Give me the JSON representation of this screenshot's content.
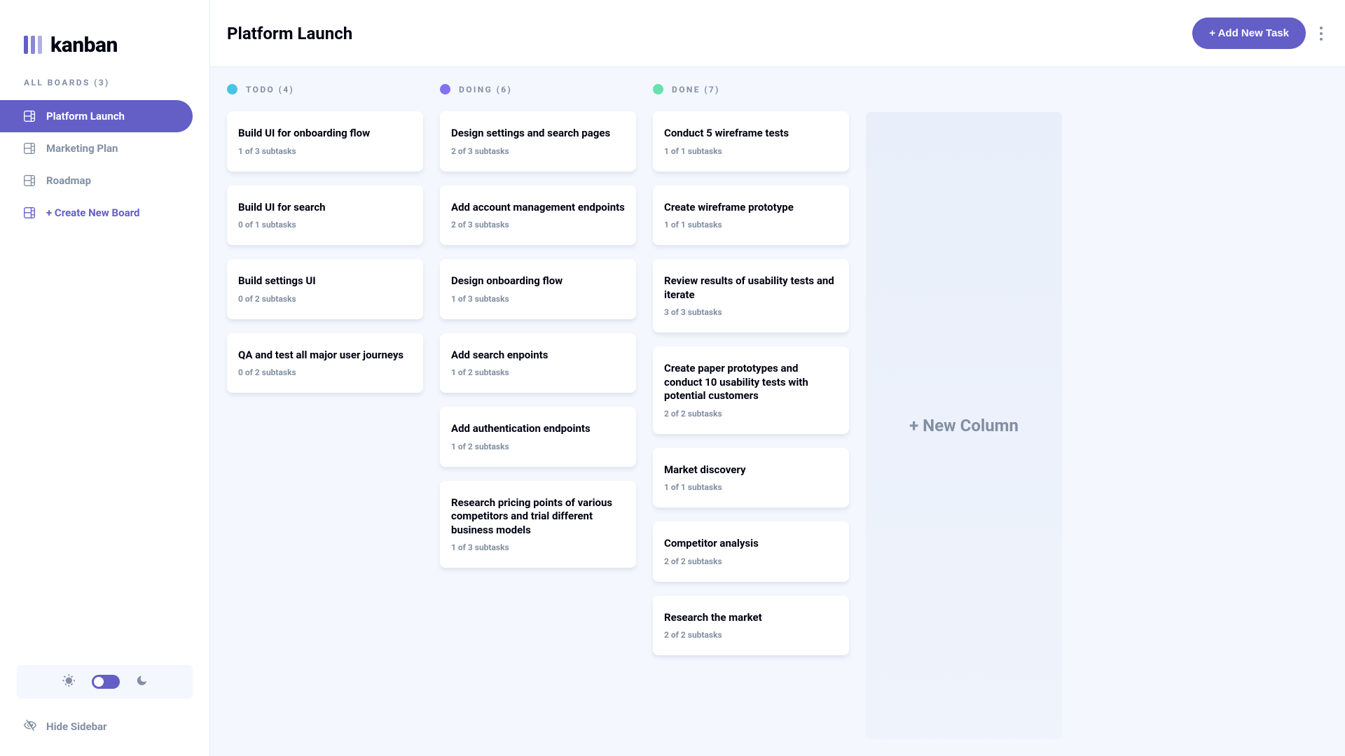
{
  "logo_text": "kanban",
  "sidebar": {
    "header_label": "ALL BOARDS (3)",
    "boards": [
      {
        "label": "Platform Launch",
        "active": true
      },
      {
        "label": "Marketing Plan",
        "active": false
      },
      {
        "label": "Roadmap",
        "active": false
      }
    ],
    "create_board_label": "+ Create New Board",
    "hide_sidebar_label": "Hide Sidebar"
  },
  "header": {
    "title": "Platform Launch",
    "add_task_label": "+ Add New Task"
  },
  "columns": [
    {
      "title": "TODO (4)",
      "color": "#49c4e5",
      "cards": [
        {
          "title": "Build UI for onboarding flow",
          "sub": "1 of 3 subtasks"
        },
        {
          "title": "Build UI for search",
          "sub": "0 of 1 subtasks"
        },
        {
          "title": "Build settings UI",
          "sub": "0 of 2 subtasks"
        },
        {
          "title": "QA and test all major user journeys",
          "sub": "0 of 2 subtasks"
        }
      ]
    },
    {
      "title": "DOING (6)",
      "color": "#8471f2",
      "cards": [
        {
          "title": "Design settings and search pages",
          "sub": "2 of 3 subtasks"
        },
        {
          "title": "Add account management endpoints",
          "sub": "2 of 3 subtasks"
        },
        {
          "title": "Design onboarding flow",
          "sub": "1 of 3 subtasks"
        },
        {
          "title": "Add search enpoints",
          "sub": "1 of 2 subtasks"
        },
        {
          "title": "Add authentication endpoints",
          "sub": "1 of 2 subtasks"
        },
        {
          "title": "Research pricing points of various competitors and trial different business models",
          "sub": "1 of 3 subtasks"
        }
      ]
    },
    {
      "title": "DONE (7)",
      "color": "#67e2ae",
      "cards": [
        {
          "title": "Conduct 5 wireframe tests",
          "sub": "1 of 1 subtasks"
        },
        {
          "title": "Create wireframe prototype",
          "sub": "1 of 1 subtasks"
        },
        {
          "title": "Review results of usability tests and iterate",
          "sub": "3 of 3 subtasks"
        },
        {
          "title": "Create paper prototypes and conduct 10 usability tests with potential customers",
          "sub": "2 of 2 subtasks"
        },
        {
          "title": "Market discovery",
          "sub": "1 of 1 subtasks"
        },
        {
          "title": "Competitor analysis",
          "sub": "2 of 2 subtasks"
        },
        {
          "title": "Research the market",
          "sub": "2 of 2 subtasks"
        }
      ]
    }
  ],
  "new_column_label": "+ New Column"
}
